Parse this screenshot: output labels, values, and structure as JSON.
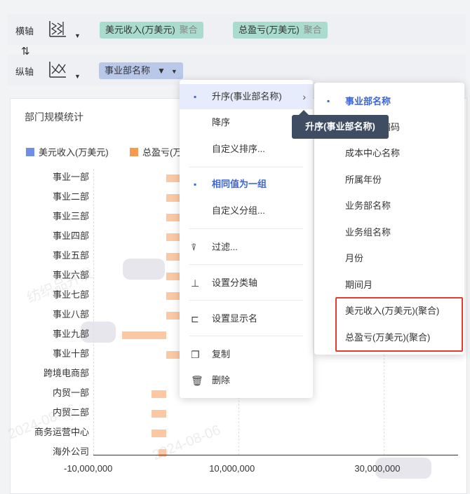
{
  "axis_panel": {
    "x_axis": {
      "label": "横轴",
      "fields": [
        {
          "name": "美元收入(万美元)",
          "agg": "聚合"
        },
        {
          "name": "总盈亏(万美元)",
          "agg": "聚合"
        }
      ]
    },
    "y_axis": {
      "label": "纵轴",
      "fields": [
        {
          "name": "事业部名称"
        }
      ]
    },
    "swap_icon": "⇅"
  },
  "chart": {
    "title": "部门规模统计",
    "legend": [
      {
        "name": "美元收入(万美元)",
        "color": "#6f8ee8"
      },
      {
        "name": "总盈亏(万美元)",
        "color": "#f79a4e"
      }
    ],
    "watermark": "2024-08-06"
  },
  "chart_data": {
    "type": "bar",
    "orientation": "horizontal",
    "title": "部门规模统计",
    "categories": [
      "事业一部",
      "事业二部",
      "事业三部",
      "事业四部",
      "事业五部",
      "事业六部",
      "事业七部",
      "事业八部",
      "事业九部",
      "事业十部",
      "跨境电商部",
      "内贸一部",
      "内贸二部",
      "商务运营中心",
      "海外公司"
    ],
    "series": [
      {
        "name": "美元收入(万美元)",
        "values": [
          0,
          0,
          0,
          0,
          0,
          0,
          0,
          0,
          0,
          0,
          0,
          0,
          0,
          0,
          0
        ]
      },
      {
        "name": "总盈亏(万美元)",
        "values": [
          6000000,
          6000000,
          6000000,
          6000000,
          6000000,
          6000000,
          6000000,
          6000000,
          -6000000,
          6000000,
          0,
          -2000000,
          -2000000,
          -2000000,
          -1000000
        ]
      }
    ],
    "x_ticks": [
      "-10,000,000",
      "10,000,000",
      "30,000,000"
    ],
    "xlim": [
      -10000000,
      40000000
    ],
    "legend_position": "top-left"
  },
  "context_menu": {
    "items": [
      {
        "label": "升序(事业部名称)",
        "marker": "▪",
        "has_submenu": true
      },
      {
        "label": "降序"
      },
      {
        "label": "自定义排序..."
      },
      {
        "label": "相同值为一组",
        "marker": "▪"
      },
      {
        "label": "自定义分组..."
      },
      {
        "label": "过滤...",
        "icon": "filter-icon"
      },
      {
        "label": "设置分类轴",
        "icon": "category-axis-icon"
      },
      {
        "label": "设置显示名",
        "icon": "display-name-icon"
      },
      {
        "label": "复制",
        "icon": "copy-icon"
      },
      {
        "label": "删除",
        "icon": "delete-icon"
      }
    ]
  },
  "tooltip": {
    "text": "升序(事业部名称)"
  },
  "submenu": {
    "items": [
      {
        "label": "事业部名称",
        "selected": true
      },
      {
        "label": "编码"
      },
      {
        "label": "成本中心名称"
      },
      {
        "label": "所属年份"
      },
      {
        "label": "业务部名称"
      },
      {
        "label": "业务组名称"
      },
      {
        "label": "月份"
      },
      {
        "label": "期间月"
      },
      {
        "label": "美元收入(万美元)(聚合)"
      },
      {
        "label": "总盈亏(万美元)(聚合)"
      }
    ]
  }
}
